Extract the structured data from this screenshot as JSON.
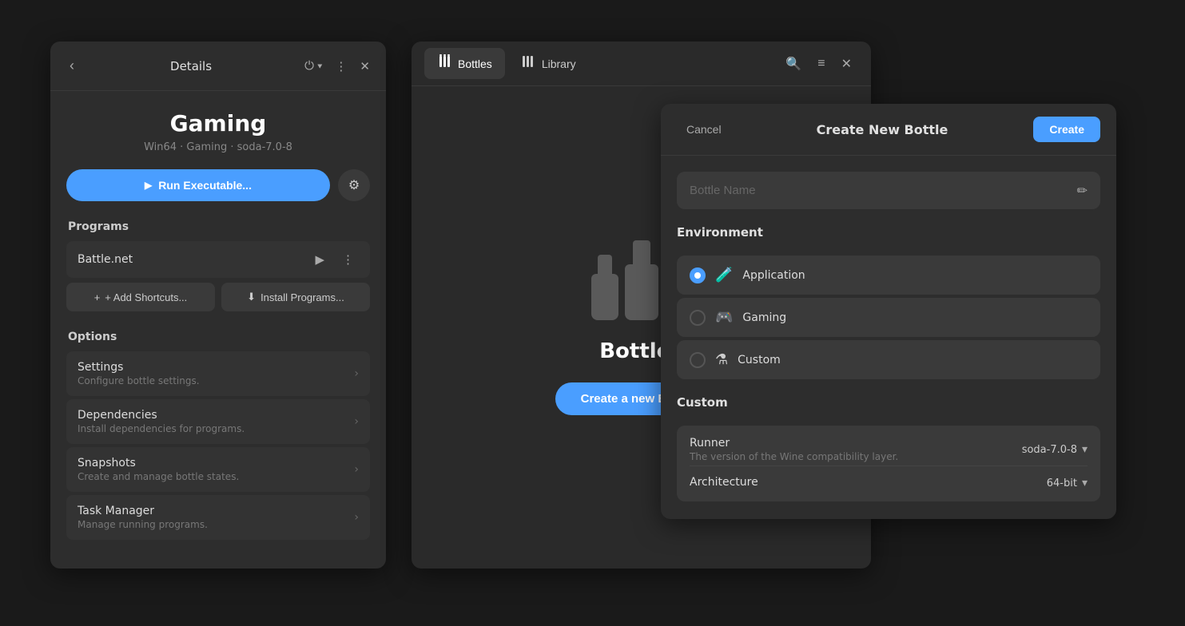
{
  "details_panel": {
    "header": {
      "title": "Details",
      "back_label": "‹",
      "power_icon": "⏻",
      "menu_icon": "⋮",
      "close_icon": "✕"
    },
    "app_name": "Gaming",
    "app_subtitle": "Win64 · Gaming · soda-7.0-8",
    "run_button": "Run Executable...",
    "settings_icon": "⚙",
    "sections": {
      "programs_label": "Programs",
      "programs": [
        {
          "name": "Battle.net"
        }
      ],
      "add_shortcuts_label": "+ Add Shortcuts...",
      "install_programs_label": "Install Programs...",
      "options_label": "Options",
      "options": [
        {
          "title": "Settings",
          "desc": "Configure bottle settings."
        },
        {
          "title": "Dependencies",
          "desc": "Install dependencies for programs."
        },
        {
          "title": "Snapshots",
          "desc": "Create and manage bottle states."
        },
        {
          "title": "Task Manager",
          "desc": "Manage running programs."
        }
      ]
    }
  },
  "bottles_window": {
    "tabs": [
      {
        "label": "Bottles",
        "icon": "|||",
        "active": true
      },
      {
        "label": "Library",
        "icon": "|||",
        "active": false
      }
    ],
    "search_icon": "🔍",
    "menu_icon": "≡",
    "close_icon": "✕",
    "empty_state": {
      "title": "Bottles",
      "create_button": "Create a new Bottle..."
    }
  },
  "create_panel": {
    "cancel_label": "Cancel",
    "title": "Create New Bottle",
    "create_label": "Create",
    "bottle_name_placeholder": "Bottle Name",
    "edit_icon": "✏",
    "environment_label": "Environment",
    "environments": [
      {
        "label": "Application",
        "icon": "🧪",
        "selected": true
      },
      {
        "label": "Gaming",
        "icon": "🎮",
        "selected": false
      },
      {
        "label": "Custom",
        "icon": "⚗",
        "selected": false
      }
    ],
    "custom_label": "Custom",
    "runner": {
      "title": "Runner",
      "desc": "The version of the Wine compatibility layer.",
      "value": "soda-7.0-8"
    },
    "architecture": {
      "title": "Architecture",
      "value": "64-bit"
    }
  }
}
